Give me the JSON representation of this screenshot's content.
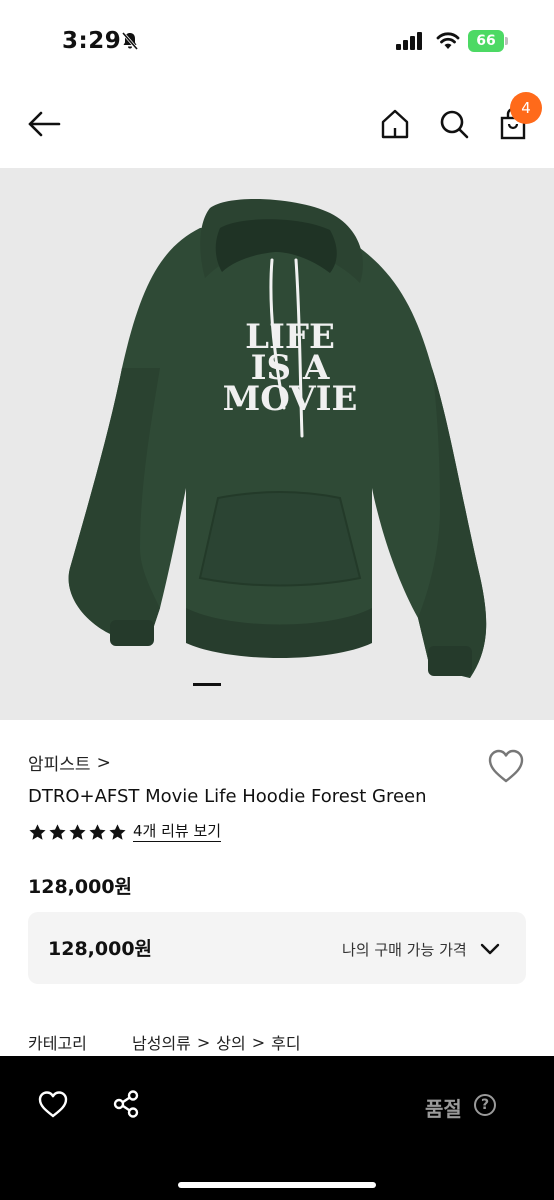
{
  "status_bar": {
    "time": "3:29",
    "battery": "66"
  },
  "nav": {
    "cart_count": "4"
  },
  "hero": {
    "print_text": [
      "LIFE",
      "IS A",
      "MOVIE"
    ]
  },
  "product": {
    "brand": "암피스트",
    "brand_chevron": ">",
    "title": "DTRO+AFST Movie Life Hoodie Forest Green",
    "rating": 5,
    "review_link": "4개 리뷰 보기",
    "price": "128,000원"
  },
  "price_box": {
    "value": "128,000원",
    "label": "나의 구매 가능 가격"
  },
  "category": {
    "label": "카테고리",
    "path": [
      "남성의류",
      "상의",
      "후디"
    ],
    "separator": ">"
  },
  "bottom_bar": {
    "status_label": "품절",
    "help_glyph": "?"
  },
  "colors": {
    "accent": "#ff6a1a",
    "hoodie": "#2f4a36",
    "bottom_bar": "#000000",
    "battery": "#4cd964"
  }
}
